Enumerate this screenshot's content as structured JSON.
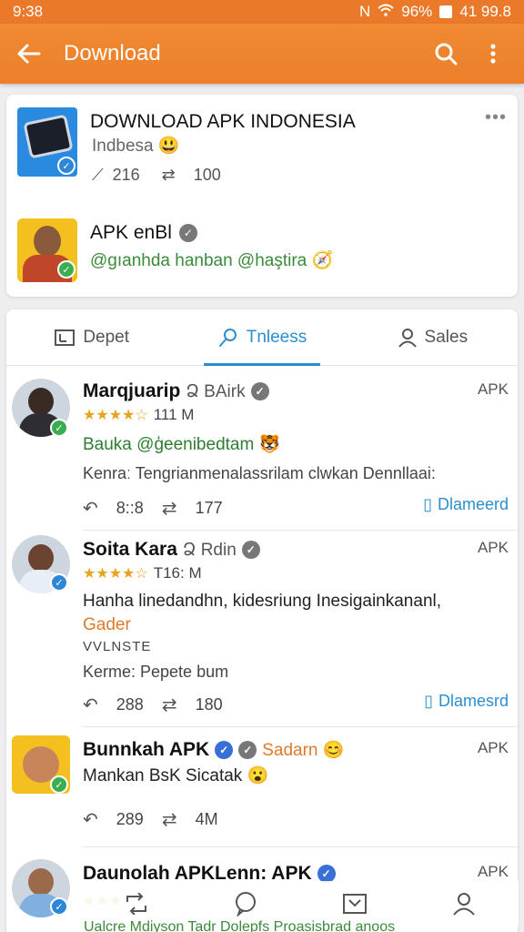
{
  "status": {
    "time": "9:38",
    "battery": "96%",
    "right": "41 99.8",
    "n": "N"
  },
  "appbar": {
    "title": "Download"
  },
  "featured": {
    "title": "DOWNLOAD APK INDONESIA",
    "subtitle": "Indbesa 😃",
    "likes": "216",
    "reposts": "100",
    "user_name": "APK enBl",
    "user_handle": "@gıanhda hanban @haştira 🧭"
  },
  "tabs": [
    {
      "label": "Depet"
    },
    {
      "label": "Tnleess"
    },
    {
      "label": "Sales"
    }
  ],
  "posts": [
    {
      "name": "Marqjuarip",
      "extra": "Ձ BAirk",
      "tag": "APK",
      "rating": "111 M",
      "line1": "Bauka @ģeenibedtam 🐯",
      "line2": "Kenraː Tengrianmenalassrilam clwkan Dennllaai:",
      "replies": "8::8",
      "reposts": "177",
      "download": "Dlameerd"
    },
    {
      "name": "Soita Kara",
      "extra": "Ձ Rdin",
      "tag": "APK",
      "rating": "T16: M",
      "line1": "Hanha linedandhn, kidesriung Inesigainkananl,",
      "line2": "Gader",
      "line3": "VVLNSTE",
      "line4": "Kerme: Pepete bum",
      "replies": "288",
      "reposts": "180",
      "download": "Dlamesrd"
    },
    {
      "name": "Bunnkah APK",
      "extra": "Sadarn 😊",
      "tag": "APK",
      "line1": "Mankan BsK Sicatak 😮",
      "replies": "289",
      "reposts": "4M"
    },
    {
      "name": "Daunolah APKLenn: APK",
      "tag": "APK",
      "footer": "Ualcre Mdiyson Tadr Dolepfs Proasisbrad anoos"
    }
  ],
  "colors": {
    "accent": "#ec7f2a",
    "link": "#2b8fcf",
    "verified": "#3cae52"
  }
}
